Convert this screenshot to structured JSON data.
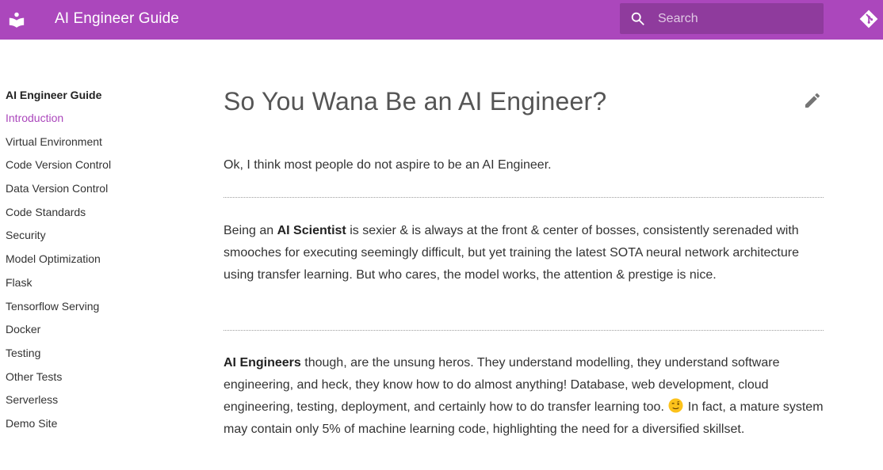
{
  "header": {
    "site_title": "AI Engineer Guide",
    "search_placeholder": "Search",
    "accent_color": "#ab47bc"
  },
  "sidebar": {
    "title": "AI Engineer Guide",
    "active_color": "#ab47bc",
    "items": [
      {
        "label": "Introduction",
        "active": true
      },
      {
        "label": "Virtual Environment"
      },
      {
        "label": "Code Version Control"
      },
      {
        "label": "Data Version Control"
      },
      {
        "label": "Code Standards"
      },
      {
        "label": "Security"
      },
      {
        "label": "Model Optimization"
      },
      {
        "label": "Flask"
      },
      {
        "label": "Tensorflow Serving"
      },
      {
        "label": "Docker"
      },
      {
        "label": "Testing"
      },
      {
        "label": "Other Tests"
      },
      {
        "label": "Serverless"
      },
      {
        "label": "Demo Site"
      }
    ]
  },
  "content": {
    "title": "So You Wana Be an AI Engineer?",
    "p1": "Ok, I think most people do not aspire to be an AI Engineer.",
    "p2_bold": "AI Scientist",
    "p2_pre": "Being an ",
    "p2_post": " is sexier & is always at the front & center of bosses, consistently serenaded with smooches for executing seemingly difficult, but yet training the latest SOTA neural network architecture using transfer learning. But who cares, the model works, the attention & prestige is nice.",
    "p3_bold": "AI Engineers",
    "p3_mid": " though, are the unsung heros. They understand modelling, they understand software engineering, and heck, they know how to do almost anything! Database, web development, cloud engineering, testing, deployment, and certainly how to do transfer learning too. ",
    "p3_post": " In fact, a mature system may contain only 5% of machine learning code, highlighting the need for a diversified skillset."
  },
  "icons": {
    "logo": "book-reader-icon",
    "search": "search-icon",
    "repo": "git-icon",
    "edit": "pencil-icon",
    "emoji": "winking-face-emoji"
  }
}
